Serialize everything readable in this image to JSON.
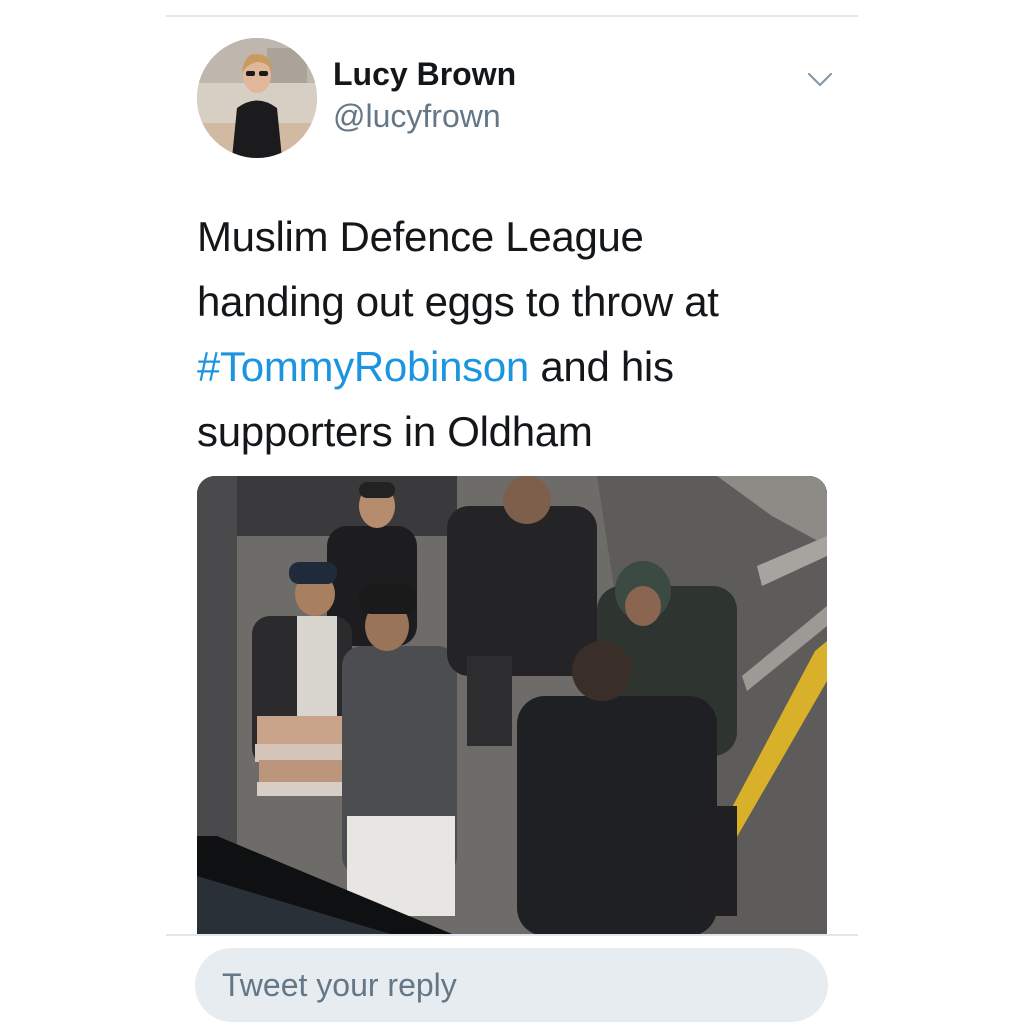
{
  "tweet": {
    "author_name": "Lucy Brown",
    "author_handle": "@lucyfrown",
    "text_lines": [
      [
        "Muslim Defence League"
      ],
      [
        "handing out eggs to throw at"
      ],
      [
        "#TommyRobinson",
        " and his"
      ],
      [
        "supporters in Oldham"
      ]
    ],
    "hashtag": "#TommyRobinson",
    "menu_icon": "chevron-down-icon",
    "media_description": "photo"
  },
  "reply": {
    "placeholder": "Tweet your reply"
  },
  "colors": {
    "text": "#14171a",
    "secondary": "#657786",
    "link": "#1b95e0",
    "divider": "#e1e8ed",
    "reply_bg": "#e6ecf0"
  }
}
